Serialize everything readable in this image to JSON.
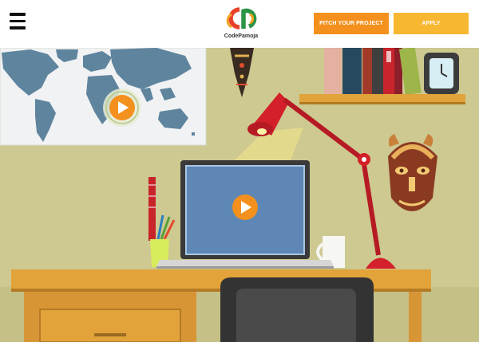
{
  "header": {
    "menu_icon": "hamburger-menu-icon",
    "logo_text": "CodePamoja",
    "pitch_button": "PITCH YOUR PROJECT",
    "apply_button": "APPLY"
  },
  "colors": {
    "wall": "#cdc990",
    "desk": "#e2a33a",
    "accent_orange": "#f4911e",
    "apply_yellow": "#f7b731",
    "lamp_red": "#d3202a",
    "map_bg": "#f1f2f3",
    "map_land": "#5f849e",
    "screen_blue": "#5e87b6"
  },
  "hero": {
    "play_icons": [
      "play-button-icon",
      "play-button-icon"
    ]
  }
}
